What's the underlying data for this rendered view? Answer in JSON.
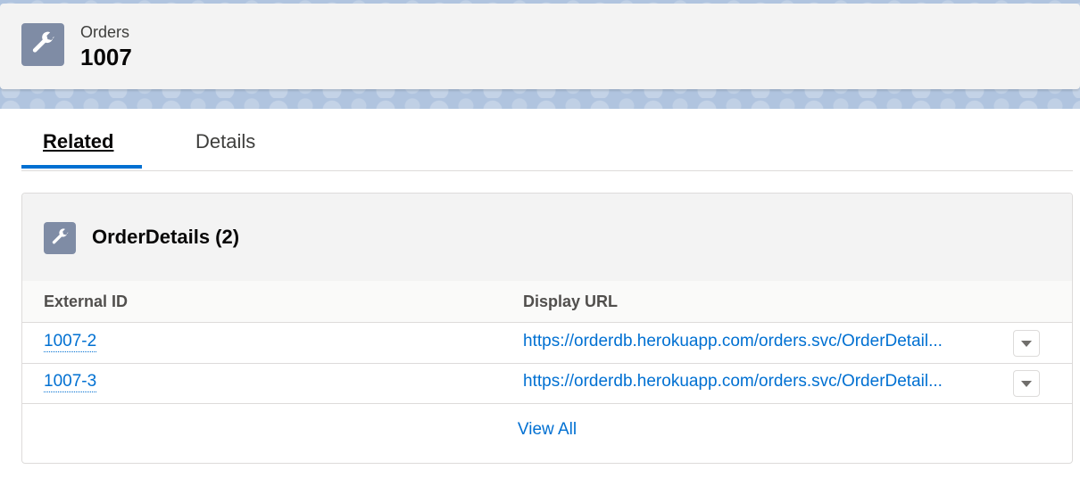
{
  "header": {
    "object_type": "Orders",
    "record_name": "1007",
    "icon": "wrench-icon"
  },
  "tabs": [
    {
      "label": "Related",
      "active": true
    },
    {
      "label": "Details",
      "active": false
    }
  ],
  "related_list": {
    "title": "OrderDetails (2)",
    "icon": "wrench-icon",
    "columns": [
      "External ID",
      "Display URL"
    ],
    "rows": [
      {
        "external_id": "1007-2",
        "display_url": "https://orderdb.herokuapp.com/orders.svc/OrderDetail..."
      },
      {
        "external_id": "1007-3",
        "display_url": "https://orderdb.herokuapp.com/orders.svc/OrderDetail..."
      }
    ],
    "row_menu_icon": "chevron-down-icon",
    "view_all_label": "View All"
  },
  "colors": {
    "accent": "#0070d2",
    "icon_bg": "#7f8ca5",
    "header_bg": "#f3f3f3"
  }
}
